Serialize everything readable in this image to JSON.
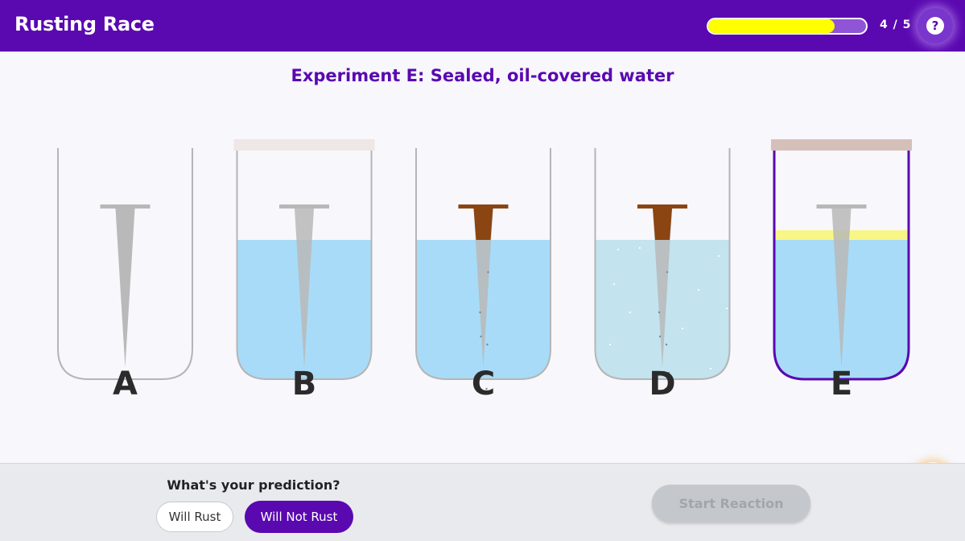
{
  "header": {
    "title": "Rusting Race",
    "progress_text": "4 / 5",
    "progress_fraction": 0.8,
    "help_icon": "question-icon"
  },
  "experiment": {
    "title": "Experiment E: Sealed, oil-covered water",
    "beakers": [
      {
        "label": "A",
        "lid": false,
        "liquid": "none",
        "oil": false,
        "nail": "clean",
        "bubbles": false,
        "selected": false
      },
      {
        "label": "B",
        "lid": true,
        "liquid": "water",
        "oil": false,
        "nail": "clean",
        "bubbles": false,
        "selected": false
      },
      {
        "label": "C",
        "lid": false,
        "liquid": "water",
        "oil": false,
        "nail": "rusty",
        "bubbles": true,
        "selected": false
      },
      {
        "label": "D",
        "lid": false,
        "liquid": "salt-water",
        "oil": false,
        "nail": "rusty",
        "bubbles": true,
        "selected": false
      },
      {
        "label": "E",
        "lid": true,
        "liquid": "water",
        "oil": true,
        "nail": "clean",
        "bubbles": false,
        "selected": true
      }
    ]
  },
  "hint": {
    "icon": "lightbulb-icon"
  },
  "prediction": {
    "question": "What's your prediction?",
    "options": [
      "Will Rust",
      "Will Not Rust"
    ],
    "selected": "Will Not Rust",
    "start_label": "Start Reaction"
  },
  "colors": {
    "brand": "#5a08b0",
    "progress": "#ffff00",
    "water": "#a8dbf7",
    "salt_water": "#c3e3ee",
    "rust": "#8a4512",
    "oil": "#f7f57a",
    "hint": "#fbaa33"
  }
}
